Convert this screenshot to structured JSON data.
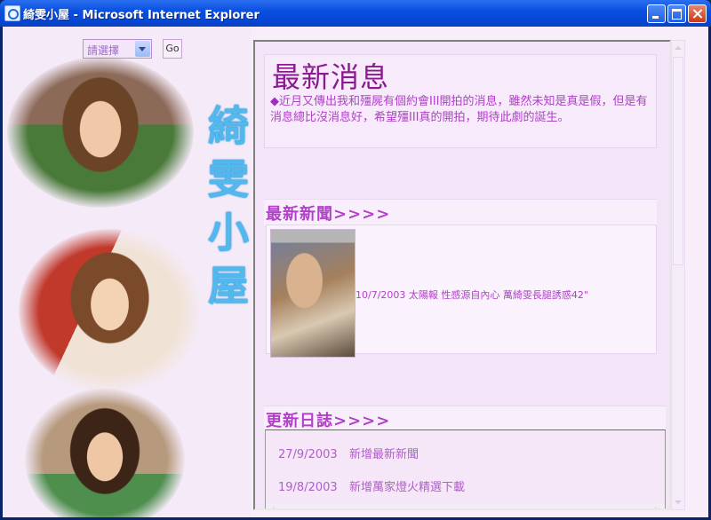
{
  "window": {
    "title": "綺雯小屋 - Microsoft Internet Explorer",
    "minimize_icon": "minimize-icon",
    "maximize_icon": "maximize-icon",
    "close_icon": "close-icon"
  },
  "sidebar": {
    "select_value": "請選擇",
    "go_label": "Go",
    "site_title_chars": [
      "綺",
      "雯",
      "小",
      "屋"
    ]
  },
  "latest": {
    "heading": "最新消息",
    "bullet": "◆",
    "body": "近月又傳出我和殭屍有個約會III開拍的消息，雖然未知是真是假，但是有消息總比沒消息好，希望殭III真的開拍，期待此劇的誕生。"
  },
  "news": {
    "heading": "最新新聞>>>>",
    "item": "10/7/2003 太陽報 性感源自內心 萬綺雯長腿誘惑42\""
  },
  "updates": {
    "heading": "更新日誌>>>>",
    "entries": [
      {
        "date": "27/9/2003",
        "text": "新增最新新聞"
      },
      {
        "date": "19/8/2003",
        "text": "新增萬家燈火精選下載"
      }
    ]
  },
  "colors": {
    "accent_purple": "#b040c8",
    "title_blue": "#52b8ee",
    "bg_pink": "#f5ebf8"
  }
}
